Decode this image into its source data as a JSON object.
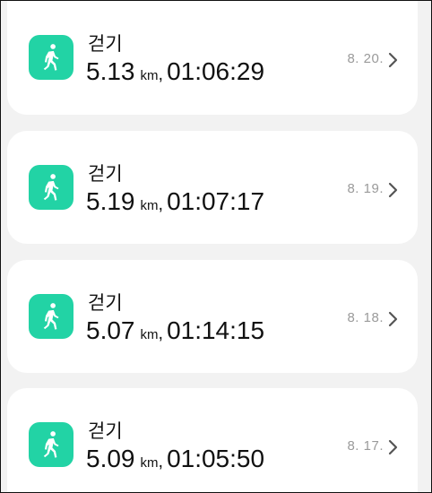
{
  "activity_list": {
    "items": [
      {
        "type": "걷기",
        "distance": "5.13",
        "unit": "km",
        "separator": ",",
        "duration": "01:06:29",
        "date": "8. 20."
      },
      {
        "type": "걷기",
        "distance": "5.19",
        "unit": "km",
        "separator": ",",
        "duration": "01:07:17",
        "date": "8. 19."
      },
      {
        "type": "걷기",
        "distance": "5.07",
        "unit": "km",
        "separator": ",",
        "duration": "01:14:15",
        "date": "8. 18."
      },
      {
        "type": "걷기",
        "distance": "5.09",
        "unit": "km",
        "separator": ",",
        "duration": "01:05:50",
        "date": "8. 17."
      }
    ]
  },
  "icons": {
    "activity": "walking-person-icon",
    "navigation": "chevron-right-icon"
  },
  "colors": {
    "background": "#f2f2f2",
    "card": "#ffffff",
    "accent": "#22d3a5",
    "date_text": "#9a9a9a"
  }
}
